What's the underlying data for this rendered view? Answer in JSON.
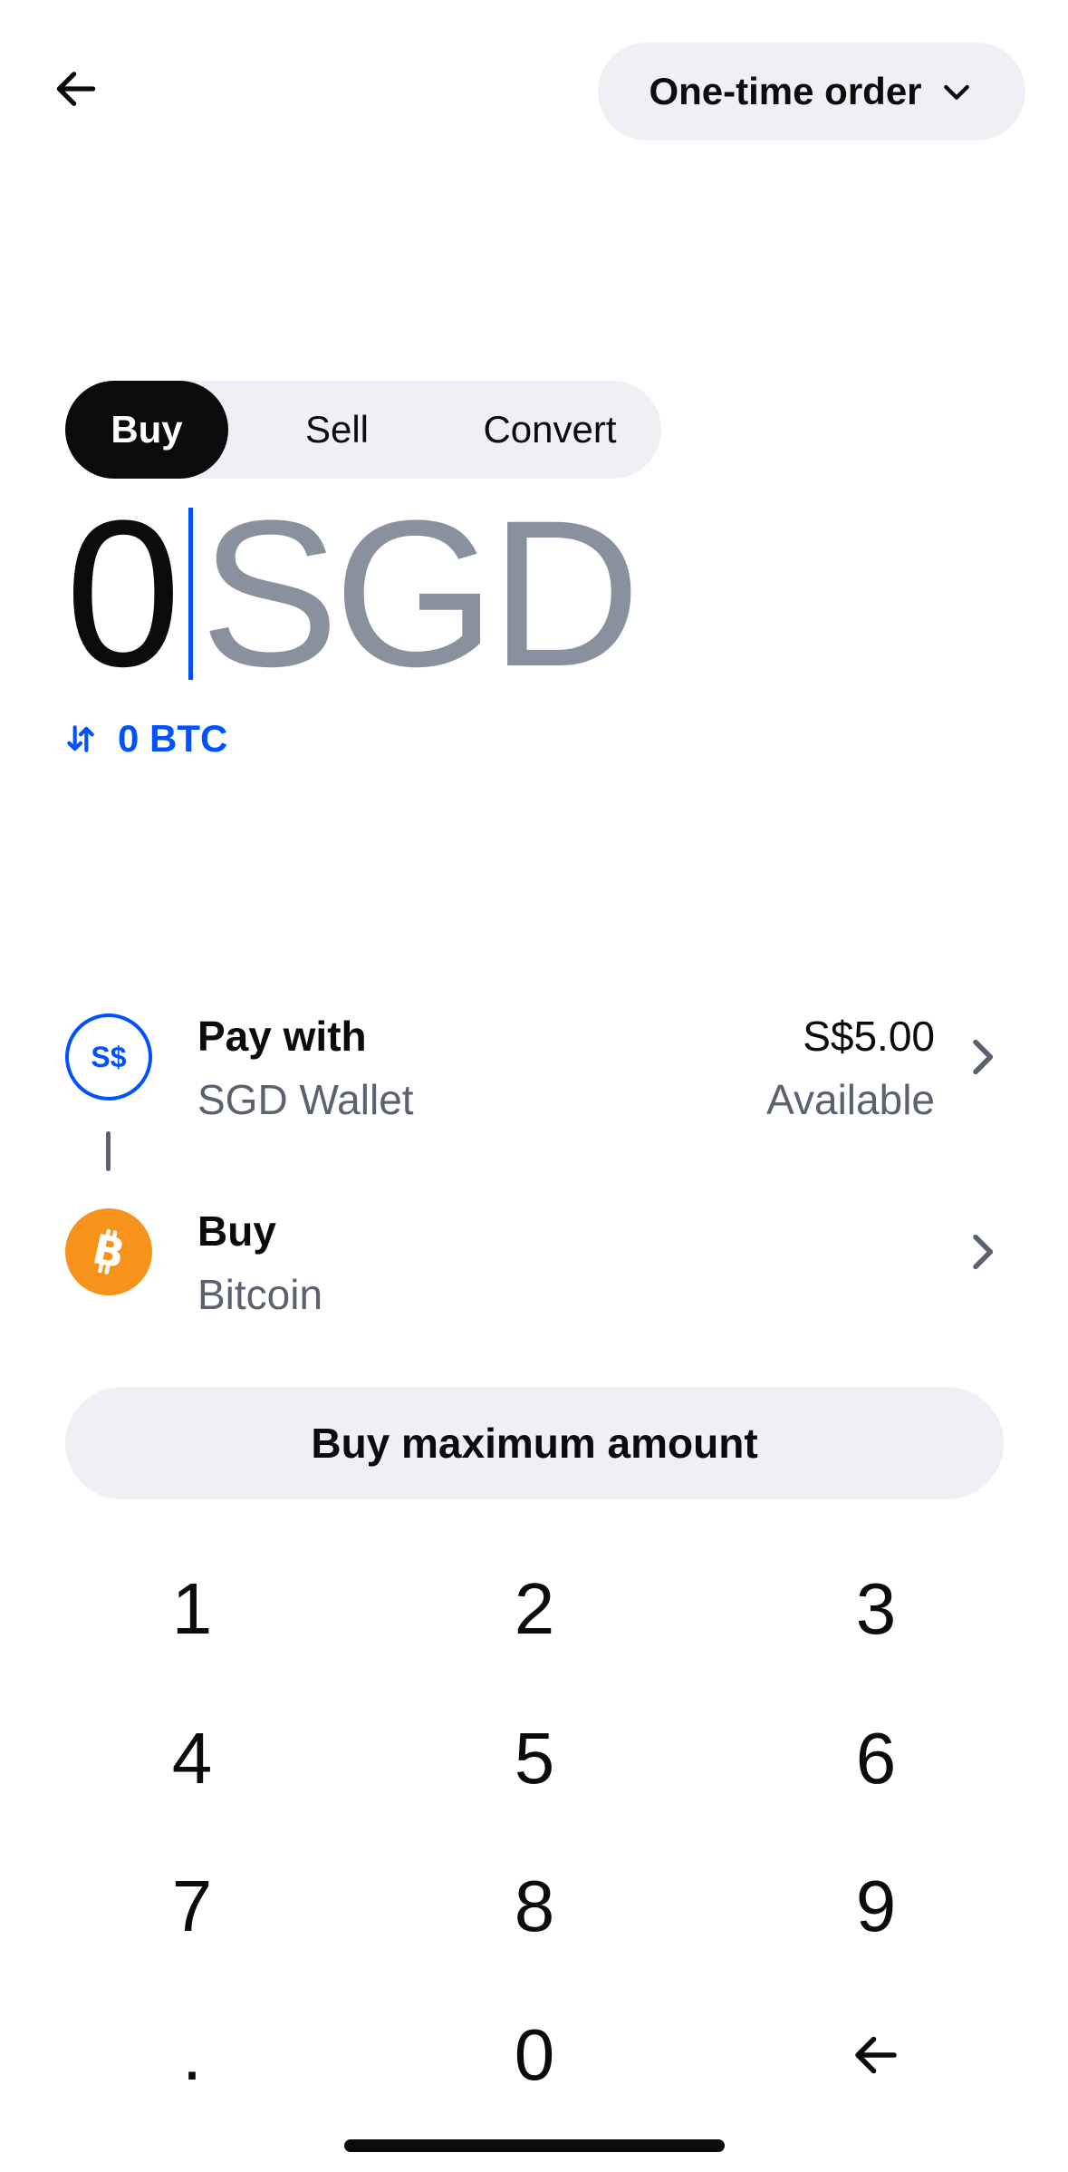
{
  "header": {
    "back_icon": "arrow-left-icon",
    "order_type": "One-time order",
    "order_dropdown_icon": "chevron-down-icon"
  },
  "tabs": [
    {
      "label": "Buy",
      "active": true
    },
    {
      "label": "Sell",
      "active": false
    },
    {
      "label": "Convert",
      "active": false
    }
  ],
  "amount": {
    "value": "0",
    "currency": "SGD",
    "converted": "0 BTC",
    "swap_icon": "swap-arrows-icon"
  },
  "pay_with": {
    "title": "Pay with",
    "method": "SGD Wallet",
    "icon_text": "S$",
    "balance": "S$5.00",
    "balance_label": "Available"
  },
  "buy_asset": {
    "title": "Buy",
    "asset": "Bitcoin",
    "icon": "bitcoin-icon"
  },
  "max_button": "Buy maximum amount",
  "keypad": {
    "keys": [
      "1",
      "2",
      "3",
      "4",
      "5",
      "6",
      "7",
      "8",
      "9",
      ".",
      "0"
    ],
    "backspace_icon": "backspace-arrow-icon"
  },
  "colors": {
    "accent": "#0052ff",
    "bitcoin": "#f7931a",
    "text": "#0a0b0d",
    "muted": "#5b616e",
    "surface": "#eef0f3"
  }
}
